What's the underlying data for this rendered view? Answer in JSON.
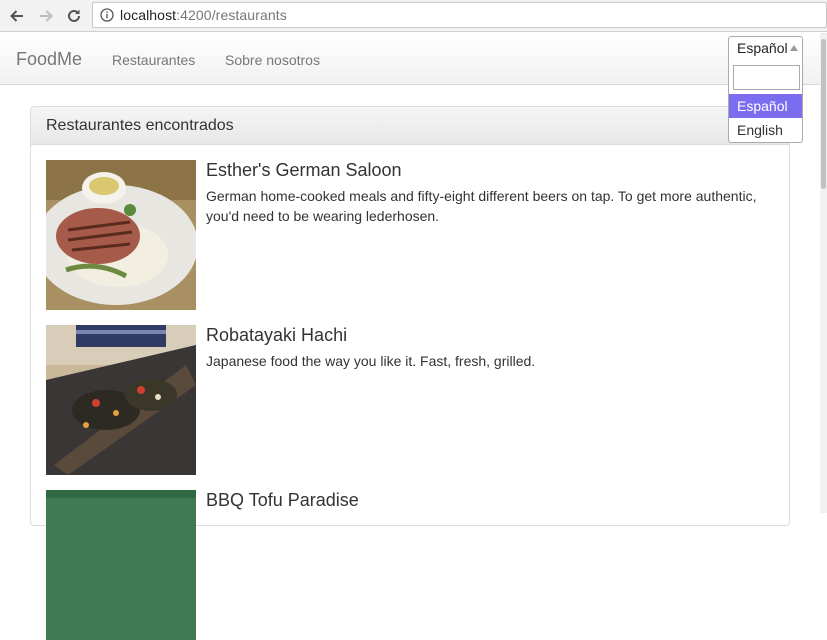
{
  "browser": {
    "url_host": "localhost",
    "url_path": ":4200/restaurants"
  },
  "navbar": {
    "brand": "FoodMe",
    "links": [
      "Restaurantes",
      "Sobre nosotros"
    ]
  },
  "language": {
    "selected": "Español",
    "search_value": "",
    "options": [
      "Español",
      "English"
    ]
  },
  "panel": {
    "heading": "Restaurantes encontrados",
    "restaurants": [
      {
        "name": "Esther's German Saloon",
        "description": "German home-cooked meals and fifty-eight different beers on tap. To get more authentic, you'd need to be wearing lederhosen."
      },
      {
        "name": "Robatayaki Hachi",
        "description": "Japanese food the way you like it. Fast, fresh, grilled."
      },
      {
        "name": "BBQ Tofu Paradise",
        "description": ""
      }
    ]
  },
  "colors": {
    "option_highlight": "#7b6cf0"
  },
  "icons": [
    "back-arrow-icon",
    "forward-arrow-icon",
    "reload-icon",
    "info-icon",
    "dropdown-arrow-icon"
  ]
}
